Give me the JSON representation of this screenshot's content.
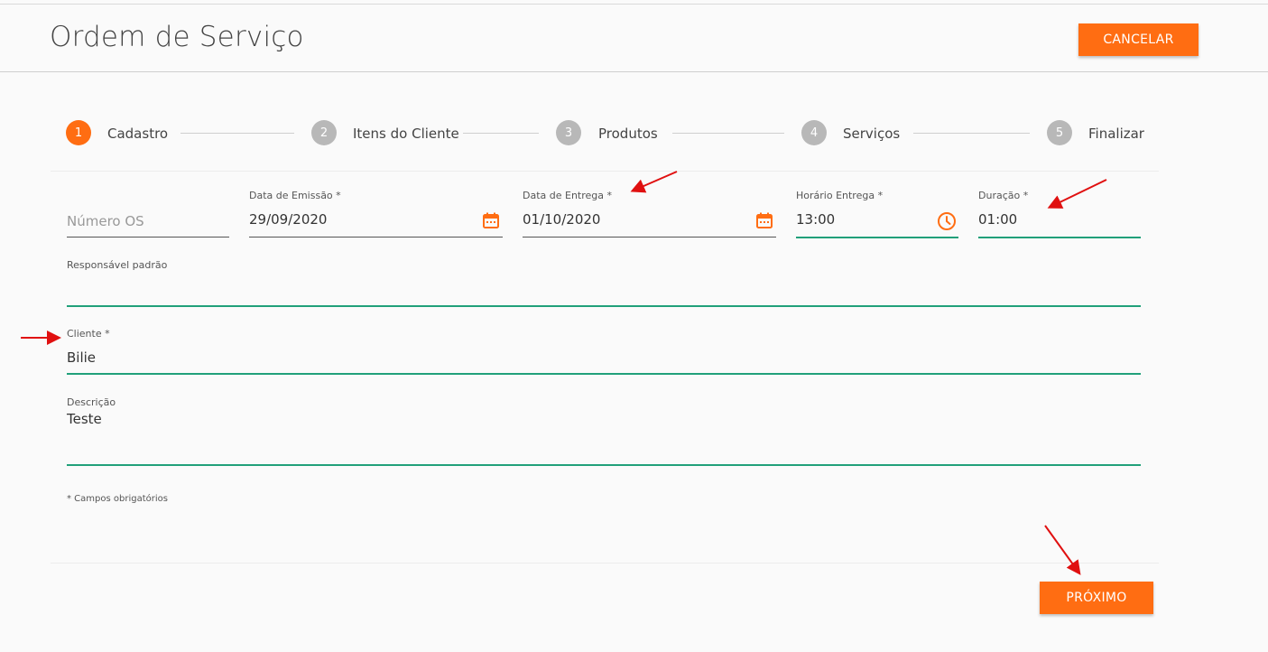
{
  "header": {
    "title": "Ordem de Serviço",
    "cancel_label": "CANCELAR"
  },
  "stepper": {
    "steps": [
      {
        "number": "1",
        "label": "Cadastro",
        "active": true
      },
      {
        "number": "2",
        "label": "Itens do Cliente",
        "active": false
      },
      {
        "number": "3",
        "label": "Produtos",
        "active": false
      },
      {
        "number": "4",
        "label": "Serviços",
        "active": false
      },
      {
        "number": "5",
        "label": "Finalizar",
        "active": false
      }
    ]
  },
  "form": {
    "numero_os": {
      "label": "",
      "placeholder": "Número OS",
      "value": ""
    },
    "data_emissao": {
      "label": "Data de Emissão *",
      "value": "29/09/2020",
      "icon": "calendar-icon"
    },
    "data_entrega": {
      "label": "Data de Entrega *",
      "value": "01/10/2020",
      "icon": "calendar-icon"
    },
    "horario_entrega": {
      "label": "Horário Entrega *",
      "value": "13:00",
      "icon": "clock-icon"
    },
    "duracao": {
      "label": "Duração *",
      "value": "01:00"
    },
    "responsavel": {
      "label": "Responsável padrão",
      "value": ""
    },
    "cliente": {
      "label": "Cliente *",
      "value": "Bilie"
    },
    "descricao": {
      "label": "Descrição",
      "value": "Teste"
    },
    "footnote": "* Campos obrigatórios"
  },
  "footer": {
    "next_label": "PRÓXIMO"
  },
  "colors": {
    "accent": "#ff6d12",
    "valid_underline": "#21a07a",
    "step_inactive": "#b8b8b8",
    "annotation_arrow": "#e01010"
  }
}
